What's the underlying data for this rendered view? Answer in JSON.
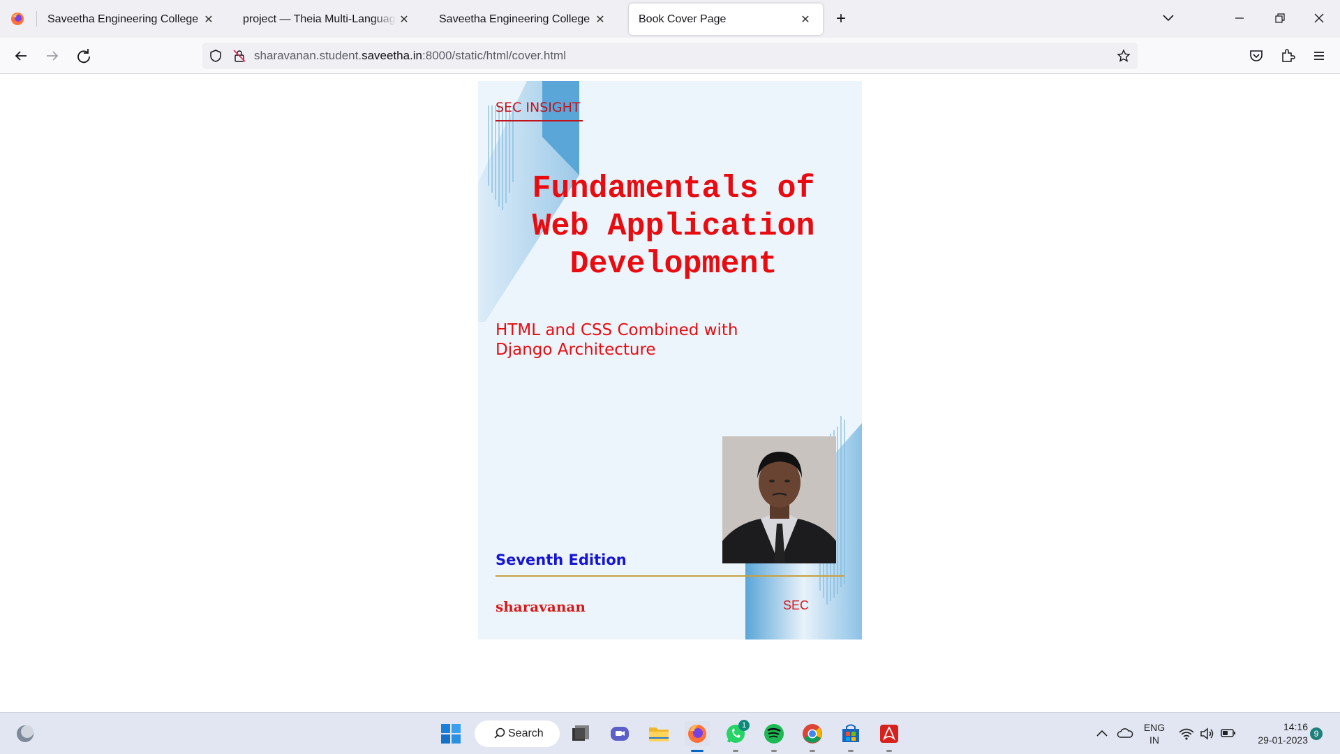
{
  "browser": {
    "tabs": [
      {
        "label": "Saveetha Engineering College",
        "active": false
      },
      {
        "label": "project — Theia Multi-Language Ex",
        "active": false
      },
      {
        "label": "Saveetha Engineering College",
        "active": false
      },
      {
        "label": "Book Cover Page",
        "active": true
      }
    ],
    "url": {
      "prefix": "sharavanan.student.",
      "host": "saveetha.in",
      "suffix": ":8000/static/html/cover.html"
    }
  },
  "cover": {
    "series": "SEC INSIGHT",
    "title_lines": [
      "Fundamentals of",
      "Web Application",
      "Development"
    ],
    "subtitle": "HTML and CSS Combined with Django Architecture",
    "edition": "Seventh Edition",
    "author": "sharavanan",
    "publisher": "SEC",
    "colors": {
      "title": "#e80c10",
      "edition": "#1414d4",
      "background": "#edf5fc",
      "accent_blue": "#5aa6d8"
    }
  },
  "taskbar": {
    "search_label": "Search",
    "whatsapp_badge": "1",
    "lang_line1": "ENG",
    "lang_line2": "IN",
    "time": "14:16",
    "date": "29-01-2023",
    "notifications": "9",
    "icons": [
      "widgets-icon",
      "start-icon",
      "search-icon",
      "task-view-icon",
      "teams-chat-icon",
      "file-explorer-icon",
      "firefox-icon",
      "whatsapp-icon",
      "spotify-icon",
      "chrome-icon",
      "store-icon",
      "acrobat-icon"
    ]
  }
}
